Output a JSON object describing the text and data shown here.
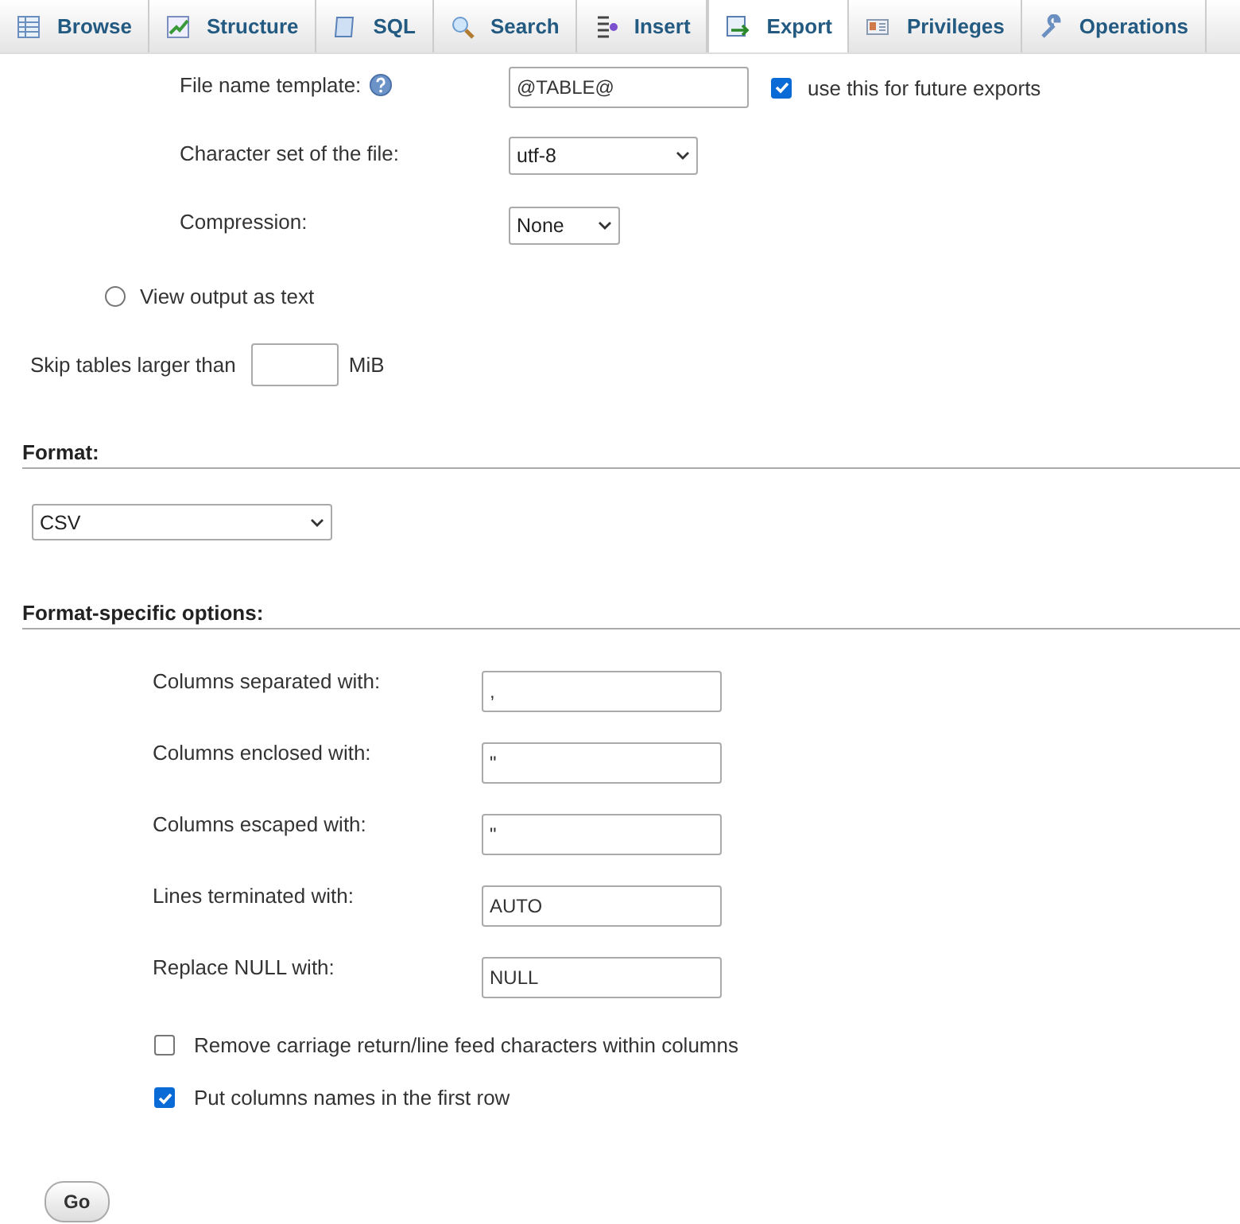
{
  "tabs": [
    {
      "label": "Browse",
      "selected": false
    },
    {
      "label": "Structure",
      "selected": false
    },
    {
      "label": "SQL",
      "selected": false
    },
    {
      "label": "Search",
      "selected": false
    },
    {
      "label": "Insert",
      "selected": false
    },
    {
      "label": "Export",
      "selected": true
    },
    {
      "label": "Privileges",
      "selected": false
    },
    {
      "label": "Operations",
      "selected": false
    }
  ],
  "output": {
    "file_name_template": {
      "label": "File name template:",
      "value": "@TABLE@",
      "remember": {
        "label": "use this for future exports",
        "checked": true
      }
    },
    "charset": {
      "label": "Character set of the file:",
      "value": "utf-8"
    },
    "compression": {
      "label": "Compression:",
      "value": "None"
    },
    "view_as_text": {
      "label": "View output as text",
      "selected": false
    },
    "skip_tables": {
      "label": "Skip tables larger than",
      "unit": "MiB"
    }
  },
  "format": {
    "heading": "Format:",
    "value": "CSV"
  },
  "format_options": {
    "heading": "Format-specific options:",
    "fields": [
      {
        "label": "Columns separated with:",
        "value": ","
      },
      {
        "label": "Columns enclosed with:",
        "value": "\""
      },
      {
        "label": "Columns escaped with:",
        "value": "\""
      },
      {
        "label": "Lines terminated with:",
        "value": "AUTO"
      },
      {
        "label": "Replace NULL with:",
        "value": "NULL"
      }
    ],
    "checkboxes": [
      {
        "label": "Remove carriage return/line feed characters within columns",
        "checked": false
      },
      {
        "label": "Put columns names in the first row",
        "checked": true
      }
    ]
  },
  "buttons": [
    "Go"
  ]
}
